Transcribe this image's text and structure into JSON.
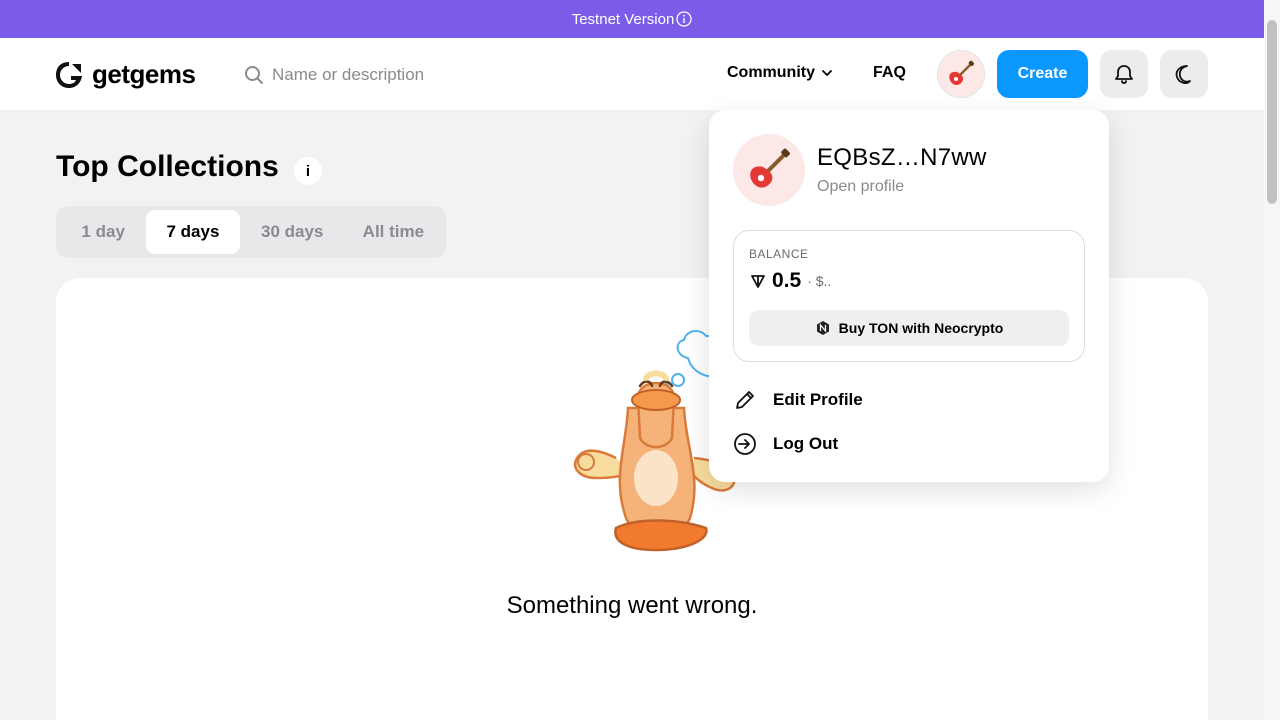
{
  "banner": {
    "text": "Testnet Version"
  },
  "header": {
    "logo_text": "getgems",
    "search_placeholder": "Name or description",
    "community_label": "Community",
    "faq_label": "FAQ",
    "create_label": "Create"
  },
  "main": {
    "title": "Top Collections",
    "info_glyph": "i",
    "tabs": [
      {
        "label": "1 day",
        "active": false
      },
      {
        "label": "7 days",
        "active": true
      },
      {
        "label": "30 days",
        "active": false
      },
      {
        "label": "All time",
        "active": false
      }
    ],
    "error_message": "Something went wrong."
  },
  "dropdown": {
    "wallet": "EQBsZ…N7ww",
    "open_profile": "Open profile",
    "balance_label": "BALANCE",
    "balance_amount": "0.5",
    "balance_usd": "· $..",
    "buy_label": "Buy TON with Neocrypto",
    "menu": {
      "edit_profile": "Edit Profile",
      "log_out": "Log Out"
    }
  },
  "colors": {
    "banner": "#7b5ce8",
    "accent": "#0a98ff",
    "avatar_bg": "#fde8e8"
  },
  "icons": [
    "info-icon",
    "getgems-logo-icon",
    "search-icon",
    "chevron-down-icon",
    "guitar-icon",
    "bell-icon",
    "moon-icon",
    "ton-icon",
    "neocrypto-icon",
    "pencil-icon",
    "logout-icon",
    "duck-illustration"
  ]
}
